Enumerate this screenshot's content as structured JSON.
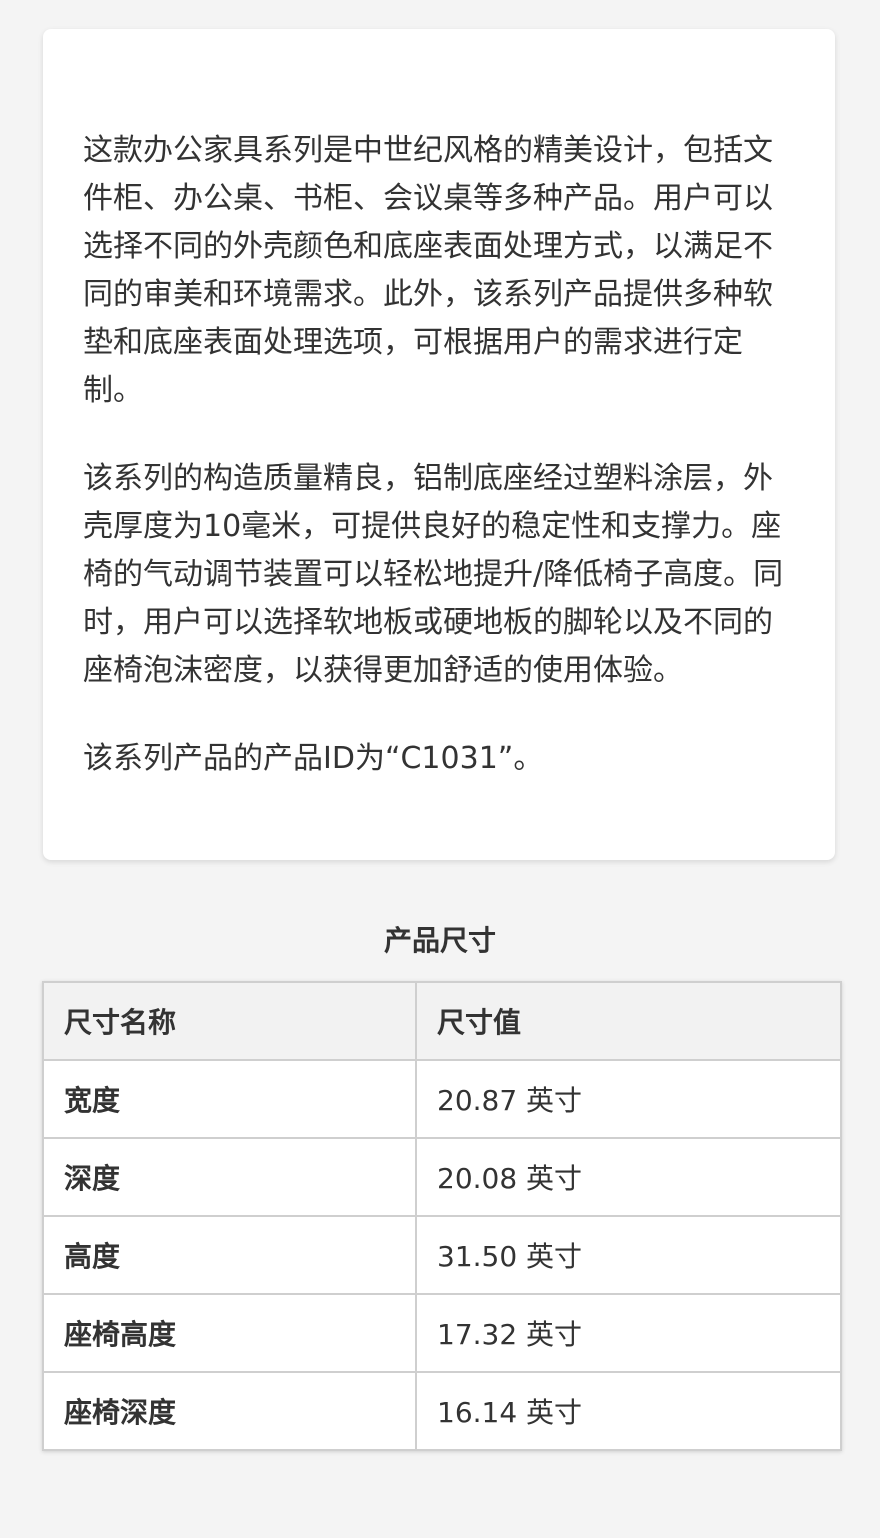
{
  "description": {
    "paragraphs": [
      "这款办公家具系列是中世纪风格的精美设计，包括文件柜、办公桌、书柜、会议桌等多种产品。用户可以选择不同的外壳颜色和底座表面处理方式，以满足不同的审美和环境需求。此外，该系列产品提供多种软垫和底座表面处理选项，可根据用户的需求进行定制。",
      "该系列的构造质量精良，铝制底座经过塑料涂层，外壳厚度为10毫米，可提供良好的稳定性和支撑力。座椅的气动调节装置可以轻松地提升/降低椅子高度。同时，用户可以选择软地板或硬地板的脚轮以及不同的座椅泡沫密度，以获得更加舒适的使用体验。",
      "该系列产品的产品ID为“C1031”。"
    ]
  },
  "dimensions": {
    "title": "产品尺寸",
    "headers": [
      "尺寸名称",
      "尺寸值"
    ],
    "rows": [
      {
        "name": "宽度",
        "value": "20.87 英寸"
      },
      {
        "name": "深度",
        "value": "20.08 英寸"
      },
      {
        "name": "高度",
        "value": "31.50 英寸"
      },
      {
        "name": "座椅高度",
        "value": "17.32 英寸"
      },
      {
        "name": "座椅深度",
        "value": "16.14 英寸"
      }
    ]
  }
}
